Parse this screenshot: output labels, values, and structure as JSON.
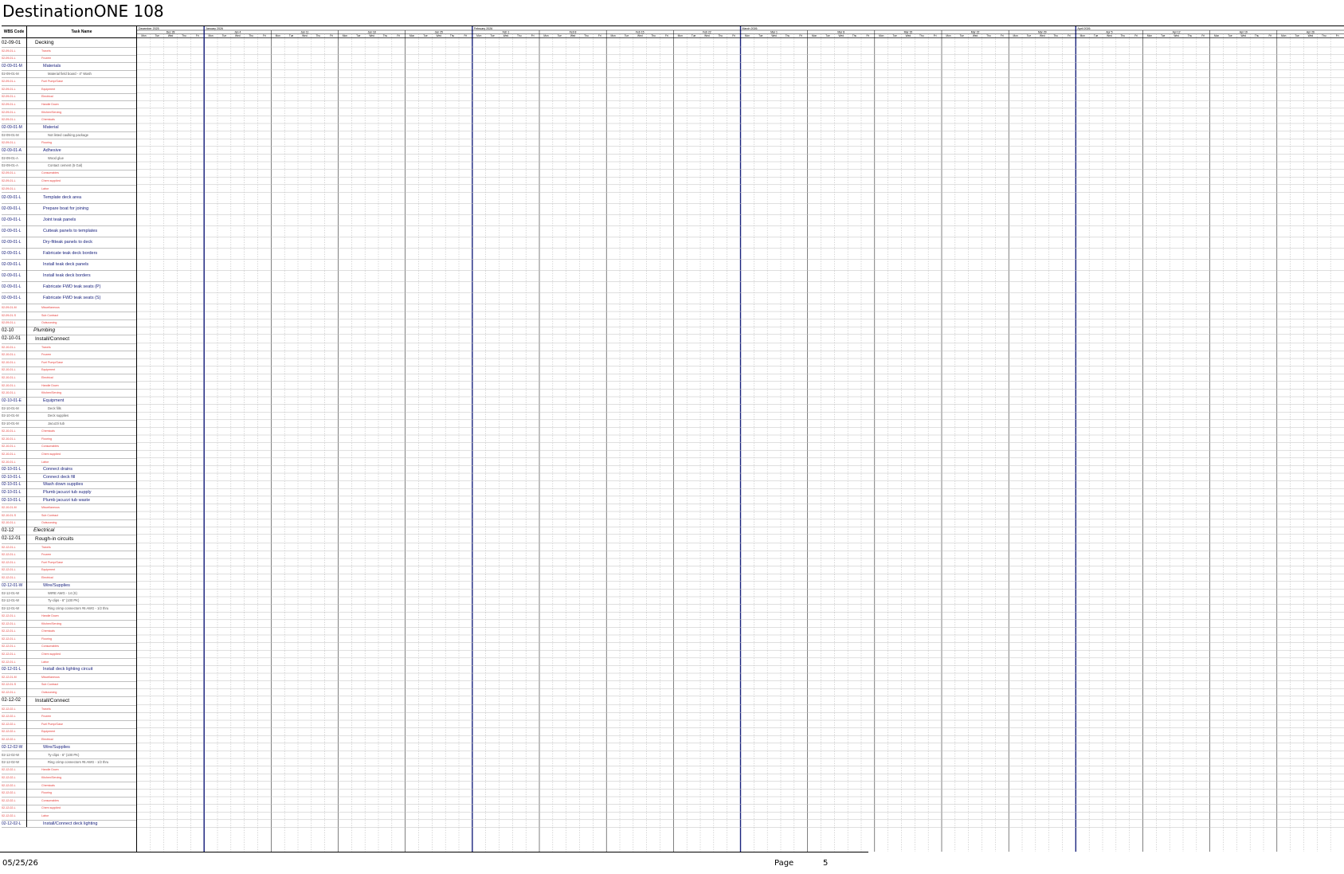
{
  "document": {
    "title": "DestinationONE 108",
    "footer": {
      "date": "05/25/26",
      "page_label": "Page",
      "page_number": "5"
    }
  },
  "columns": {
    "code": "WBS Code",
    "name": "Task Name"
  },
  "timeline": {
    "months": [
      "December 2025",
      "January 2026",
      "February 2026",
      "March 2026",
      "April 2026"
    ],
    "weeks": [
      "Dec 28",
      "Jan 4",
      "Jan 11",
      "Jan 18",
      "Jan 25",
      "Feb 1",
      "Feb 8",
      "Feb 15",
      "Feb 22",
      "Mar 1",
      "Mar 8",
      "Mar 15",
      "Mar 22",
      "Mar 29",
      "Apr 5",
      "Apr 12",
      "Apr 19",
      "Apr 26"
    ],
    "day_labels": [
      "Mon",
      "Tue",
      "Wed",
      "Thu",
      "Fri"
    ]
  },
  "rows": [
    {
      "code": "02-09-01",
      "name": "Decking",
      "s": "blk",
      "h": 11
    },
    {
      "code": "02-09-01-L",
      "name": "Travels",
      "s": "red"
    },
    {
      "code": "02-09-01-L",
      "name": "Frozem",
      "s": "red"
    },
    {
      "code": "02-09-01-M",
      "name": "Materials",
      "s": "navy",
      "i": 1
    },
    {
      "code": "02-09-01-M",
      "name": "Material field board - 4\" Wash",
      "s": "gray",
      "i": 2
    },
    {
      "code": "02-09-01-L",
      "name": "Fuel Pump/Gase",
      "s": "red"
    },
    {
      "code": "02-09-01-L",
      "name": "Equipment",
      "s": "red"
    },
    {
      "code": "02-09-01-L",
      "name": "Electrical",
      "s": "red"
    },
    {
      "code": "02-09-01-L",
      "name": "Handle Down",
      "s": "red"
    },
    {
      "code": "02-09-01-L",
      "name": "Kitchen/Serving",
      "s": "red"
    },
    {
      "code": "02-09-01-L",
      "name": "Chemicals",
      "s": "red"
    },
    {
      "code": "02-09-01-M",
      "name": "Material",
      "s": "navy",
      "i": 1
    },
    {
      "code": "02-09-01-M",
      "name": "Not listed caulking package",
      "s": "gray",
      "i": 2
    },
    {
      "code": "02-09-01-L",
      "name": "Flooring",
      "s": "red"
    },
    {
      "code": "02-09-01-A",
      "name": "Adhesive",
      "s": "navy",
      "i": 1
    },
    {
      "code": "02-09-01-A",
      "name": "Wood glue",
      "s": "gray",
      "i": 2
    },
    {
      "code": "02-09-01-A",
      "name": "Contact cement (5 Gal)",
      "s": "gray",
      "i": 2
    },
    {
      "code": "02-09-01-L",
      "name": "Consumables",
      "s": "red"
    },
    {
      "code": "02-09-01-L",
      "name": "Chem supplied",
      "s": "red"
    },
    {
      "code": "02-09-01-L",
      "name": "Labor",
      "s": "red"
    },
    {
      "code": "02-09-01-L",
      "name": "Template deck area",
      "s": "navy",
      "i": 1,
      "h": 14
    },
    {
      "code": "02-09-01-L",
      "name": "Prepare boat for joining",
      "s": "navy",
      "i": 1,
      "h": 14
    },
    {
      "code": "02-09-01-L",
      "name": "Joint teak panels",
      "s": "navy",
      "i": 1,
      "h": 14
    },
    {
      "code": "02-09-01-L",
      "name": "Cutteak panels to templates",
      "s": "navy",
      "i": 1,
      "h": 14
    },
    {
      "code": "02-09-01-L",
      "name": "Dry-fitteak panels to deck",
      "s": "navy",
      "i": 1,
      "h": 14
    },
    {
      "code": "02-09-01-L",
      "name": "Fabricate teak deck borders",
      "s": "navy",
      "i": 1,
      "h": 14
    },
    {
      "code": "02-09-01-L",
      "name": "Install teak deck panels",
      "s": "navy",
      "i": 1,
      "h": 14
    },
    {
      "code": "02-09-01-L",
      "name": "Install teak deck borders",
      "s": "navy",
      "i": 1,
      "h": 14
    },
    {
      "code": "02-09-01-L",
      "name": "Fabricate FWD teak seats (P)",
      "s": "navy",
      "i": 1,
      "h": 14
    },
    {
      "code": "02-09-01-L",
      "name": "Fabricate FWD teak seats (S)",
      "s": "navy",
      "i": 1,
      "h": 14
    },
    {
      "code": "02-09-01-M",
      "name": "Miscellaneous",
      "s": "red"
    },
    {
      "code": "02-09-01-S",
      "name": "Sub Contract",
      "s": "red"
    },
    {
      "code": "02-09-01-L",
      "name": "Outsourcing",
      "s": "red"
    },
    {
      "code": "02-10",
      "name": "Plumbing",
      "s": "blk",
      "it": 1
    },
    {
      "code": "02-10-01",
      "name": "Install/Connect",
      "s": "blk",
      "h": 11
    },
    {
      "code": "02-10-01-L",
      "name": "Travels",
      "s": "red"
    },
    {
      "code": "02-10-01-L",
      "name": "Frozem",
      "s": "red"
    },
    {
      "code": "02-10-01-L",
      "name": "Fuel Pump/Gase",
      "s": "red"
    },
    {
      "code": "02-10-01-L",
      "name": "Equipment",
      "s": "red"
    },
    {
      "code": "02-10-01-L",
      "name": "Electrical",
      "s": "red"
    },
    {
      "code": "02-10-01-L",
      "name": "Handle Down",
      "s": "red"
    },
    {
      "code": "02-10-01-L",
      "name": "Kitchen/Serving",
      "s": "red"
    },
    {
      "code": "02-10-01-E",
      "name": "Equipment",
      "s": "navy",
      "i": 1
    },
    {
      "code": "02-10-01-M",
      "name": "Deck fills",
      "s": "gray",
      "i": 2
    },
    {
      "code": "02-10-01-M",
      "name": "Deck supplies",
      "s": "gray",
      "i": 2
    },
    {
      "code": "02-10-01-M",
      "name": "Jacuzzi tub",
      "s": "gray",
      "i": 2
    },
    {
      "code": "02-10-01-L",
      "name": "Chemicals",
      "s": "red"
    },
    {
      "code": "02-10-01-L",
      "name": "Flooring",
      "s": "red"
    },
    {
      "code": "02-10-01-L",
      "name": "Consumables",
      "s": "red"
    },
    {
      "code": "02-10-01-L",
      "name": "Chem supplied",
      "s": "red"
    },
    {
      "code": "02-10-01-L",
      "name": "Labor",
      "s": "red"
    },
    {
      "code": "02-10-01-L",
      "name": "Connect drains",
      "s": "navy",
      "i": 1
    },
    {
      "code": "02-10-01-L",
      "name": "Connect deck fill",
      "s": "navy",
      "i": 1
    },
    {
      "code": "02-10-01-L",
      "name": "Wash down supplies",
      "s": "navy",
      "i": 1
    },
    {
      "code": "02-10-01-L",
      "name": "Plumb jacuzzi tub supply",
      "s": "navy",
      "i": 1
    },
    {
      "code": "02-10-01-L",
      "name": "Plumb jacuzzi tub waste",
      "s": "navy",
      "i": 1
    },
    {
      "code": "02-10-01-M",
      "name": "Miscellaneous",
      "s": "red"
    },
    {
      "code": "02-10-01-S",
      "name": "Sub Contract",
      "s": "red"
    },
    {
      "code": "02-10-01-L",
      "name": "Outsourcing",
      "s": "red"
    },
    {
      "code": "02-12",
      "name": "Electrical",
      "s": "blk",
      "it": 1
    },
    {
      "code": "02-12-01",
      "name": "Rough-in circuits",
      "s": "blk",
      "h": 11
    },
    {
      "code": "02-12-01-L",
      "name": "Travels",
      "s": "red"
    },
    {
      "code": "02-12-01-L",
      "name": "Frozem",
      "s": "red"
    },
    {
      "code": "02-12-01-L",
      "name": "Fuel Pump/Gase",
      "s": "red"
    },
    {
      "code": "02-12-01-L",
      "name": "Equipment",
      "s": "red"
    },
    {
      "code": "02-12-01-L",
      "name": "Electrical",
      "s": "red"
    },
    {
      "code": "02-12-01-W",
      "name": "Wire/Supplies",
      "s": "navy",
      "i": 1
    },
    {
      "code": "02-12-01-W",
      "name": "WIRE AWG - 14 (S)",
      "s": "gray",
      "i": 2
    },
    {
      "code": "02-12-01-W",
      "name": "Ty-clips - 6\" (100 PK)",
      "s": "gray",
      "i": 2
    },
    {
      "code": "02-12-01-W",
      "name": "Ring crimp connectors #6 AWG - 1/2 thru",
      "s": "gray",
      "i": 2
    },
    {
      "code": "02-12-01-L",
      "name": "Handle Down",
      "s": "red"
    },
    {
      "code": "02-12-01-L",
      "name": "Kitchen/Serving",
      "s": "red"
    },
    {
      "code": "02-12-01-L",
      "name": "Chemicals",
      "s": "red"
    },
    {
      "code": "02-12-01-L",
      "name": "Flooring",
      "s": "red"
    },
    {
      "code": "02-12-01-L",
      "name": "Consumables",
      "s": "red"
    },
    {
      "code": "02-12-01-L",
      "name": "Chem supplied",
      "s": "red"
    },
    {
      "code": "02-12-01-L",
      "name": "Labor",
      "s": "red"
    },
    {
      "code": "02-12-01-L",
      "name": "Install deck lighting circuit",
      "s": "navy",
      "i": 1
    },
    {
      "code": "02-12-01-M",
      "name": "Miscellaneous",
      "s": "red"
    },
    {
      "code": "02-12-01-S",
      "name": "Sub Contract",
      "s": "red"
    },
    {
      "code": "02-12-01-L",
      "name": "Outsourcing",
      "s": "red"
    },
    {
      "code": "02-12-02",
      "name": "Install/Connect",
      "s": "blk",
      "h": 11
    },
    {
      "code": "02-12-02-L",
      "name": "Travels",
      "s": "red"
    },
    {
      "code": "02-12-02-L",
      "name": "Frozem",
      "s": "red"
    },
    {
      "code": "02-12-02-L",
      "name": "Fuel Pump/Gase",
      "s": "red"
    },
    {
      "code": "02-12-02-L",
      "name": "Equipment",
      "s": "red"
    },
    {
      "code": "02-12-02-L",
      "name": "Electrical",
      "s": "red"
    },
    {
      "code": "02-12-02-W",
      "name": "Wire/Supplies",
      "s": "navy",
      "i": 1
    },
    {
      "code": "02-12-02-W",
      "name": "Ty-clips - 6\" (100 PK)",
      "s": "gray",
      "i": 2
    },
    {
      "code": "02-12-02-W",
      "name": "Ring crimp connectors #6 AWG - 1/2 thru",
      "s": "gray",
      "i": 2
    },
    {
      "code": "02-12-02-L",
      "name": "Handle Down",
      "s": "red"
    },
    {
      "code": "02-12-02-L",
      "name": "Kitchen/Serving",
      "s": "red"
    },
    {
      "code": "02-12-02-L",
      "name": "Chemicals",
      "s": "red"
    },
    {
      "code": "02-12-02-L",
      "name": "Flooring",
      "s": "red"
    },
    {
      "code": "02-12-02-L",
      "name": "Consumables",
      "s": "red"
    },
    {
      "code": "02-12-02-L",
      "name": "Chem supplied",
      "s": "red"
    },
    {
      "code": "02-12-02-L",
      "name": "Labor",
      "s": "red"
    },
    {
      "code": "02-12-02-L",
      "name": "Install/Connect deck lighting",
      "s": "navy",
      "i": 1
    }
  ]
}
